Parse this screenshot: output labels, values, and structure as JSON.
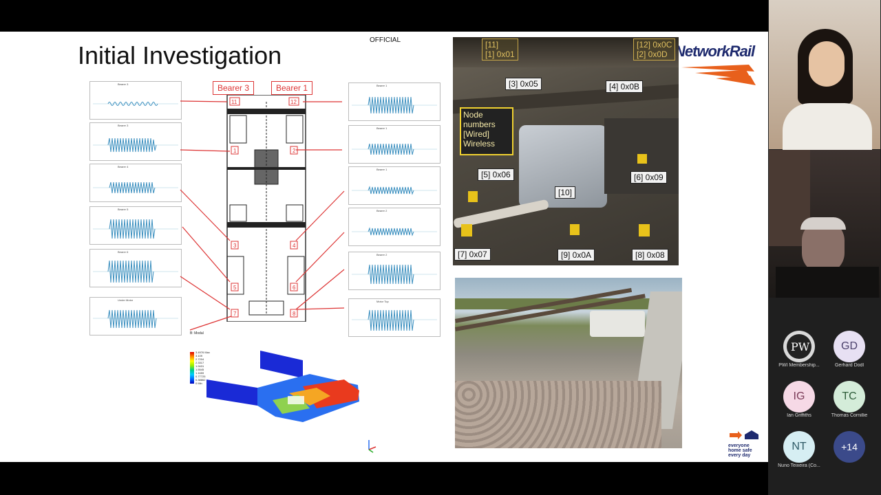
{
  "slide": {
    "title": "Initial Investigation",
    "classification": "OFFICIAL",
    "brand": "NetworkRail",
    "bearer_tags": [
      "Bearer 3",
      "Bearer 1"
    ],
    "schematic_numbers": [
      "11",
      "12",
      "1",
      "2",
      "3",
      "4",
      "5",
      "6",
      "7",
      "8"
    ],
    "plots_left": [
      "Bearer 3",
      "Bearer 3",
      "Bearer 4",
      "Bearer 5",
      "Bearer 6",
      "Under Motor"
    ],
    "plots_right": [
      "Bearer 1",
      "Bearer 1",
      "Bearer 1",
      "Bearer 2",
      "Bearer 2",
      "Motor Top"
    ],
    "fea": {
      "label": "B: Modal",
      "legend": [
        "3.4976 Max",
        "3.109",
        "2.7204",
        "2.3317",
        "1.9431",
        "1.5545",
        "1.1659",
        "0.77725",
        "0.38862",
        "0 Min"
      ]
    },
    "photo_labels": {
      "top_left": [
        "[11]",
        "[1] 0x01"
      ],
      "top_right": [
        "[12] 0x0C",
        "[2] 0x0D"
      ],
      "n3": "[3] 0x05",
      "n4": "[4] 0x0B",
      "n5": "[5] 0x06",
      "n6": "[6] 0x09",
      "n10": "[10]",
      "n7": "[7] 0x07",
      "n9": "[9] 0x0A",
      "n8": "[8] 0x08",
      "legend": [
        "Node",
        "numbers",
        "[Wired]",
        "Wireless"
      ]
    },
    "safety_logo": [
      "everyone",
      "home safe",
      "every day"
    ]
  },
  "participants": [
    {
      "initials": "",
      "name": "PWI Membership...",
      "color": "#d9d9d9"
    },
    {
      "initials": "GD",
      "name": "Gerhard Dodl",
      "color": "#e7e0f3"
    },
    {
      "initials": "IG",
      "name": "Ian Griffiths",
      "color": "#f6d9e6"
    },
    {
      "initials": "TC",
      "name": "Thomas Cornillie",
      "color": "#d4ecd9"
    },
    {
      "initials": "NT",
      "name": "Nuno Teixeira (Co...",
      "color": "#d6eef3"
    },
    {
      "initials": "+14",
      "name": "",
      "color": "#3b4a8a"
    }
  ],
  "colors": {
    "accent_red": "#d33",
    "brand_orange": "#e8601c",
    "node_yellow": "#f1d230"
  }
}
